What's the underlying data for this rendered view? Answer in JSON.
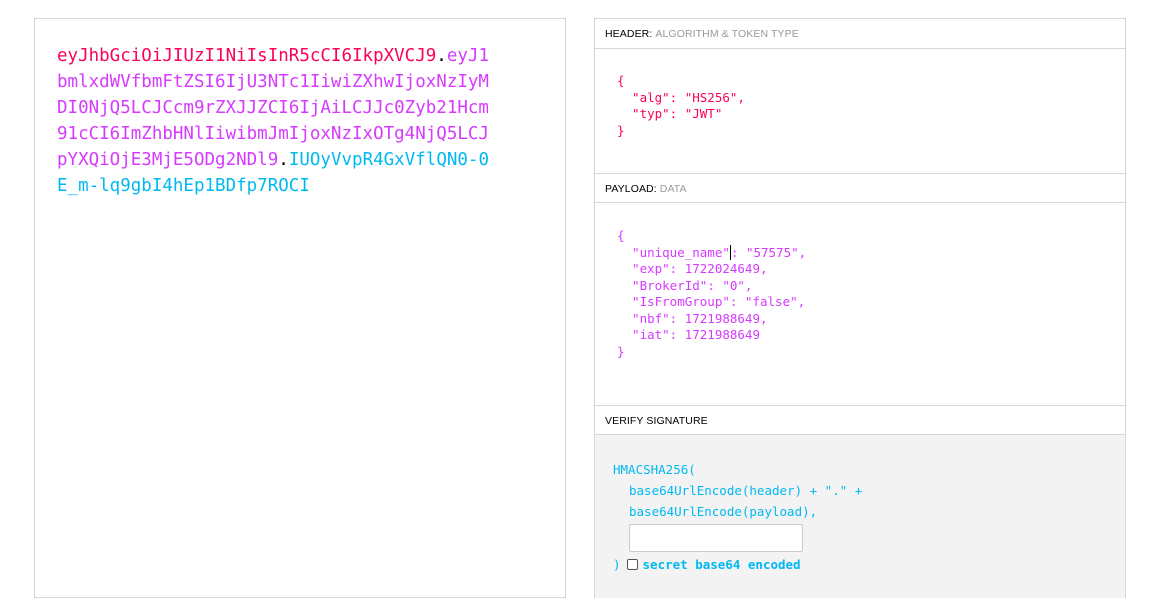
{
  "encoded": {
    "header": "eyJhbGciOiJIUzI1NiIsInR5cCI6IkpXVCJ9",
    "payload": "eyJ1bmlxdWVfbmFtZSI6IjU3NTc1IiwiZXhwIjoxNzIyMDI0NjQ5LCJCcm9rZXJJZCI6IjAiLCJJc0Zyb21Hcm91cCI6ImZhbHNlIiwibmJmIjoxNzIxOTg4NjQ5LCJpYXQiOjE3MjE5ODg2NDl9",
    "signature": "IUOyVvpR4GxVflQN0-0E_m-lq9gbI4hEp1BDfp7ROCI",
    "dot": ".",
    "colors": {
      "header": "#fb015b",
      "payload": "#d63aff",
      "signature": "#00b9f1"
    }
  },
  "decoded": {
    "header_section": {
      "title": "HEADER:",
      "subtitle": "ALGORITHM & TOKEN TYPE",
      "lines": [
        "{",
        "  \"alg\": \"HS256\",",
        "  \"typ\": \"JWT\"",
        "}"
      ]
    },
    "payload_section": {
      "title": "PAYLOAD:",
      "subtitle": "DATA",
      "open": "{",
      "first_key": "  \"unique_name\"",
      "first_rest": ": \"57575\",",
      "lines": [
        "  \"exp\": 1722024649,",
        "  \"BrokerId\": \"0\",",
        "  \"IsFromGroup\": \"false\",",
        "  \"nbf\": 1721988649,",
        "  \"iat\": 1721988649",
        "}"
      ]
    },
    "verify_section": {
      "title": "VERIFY SIGNATURE",
      "func": "HMACSHA256(",
      "line1": "base64UrlEncode(header) + \".\" +",
      "line2": "base64UrlEncode(payload),",
      "secret_value": "",
      "close": ")",
      "checkbox_label": "secret base64 encoded",
      "checkbox_checked": false
    }
  }
}
